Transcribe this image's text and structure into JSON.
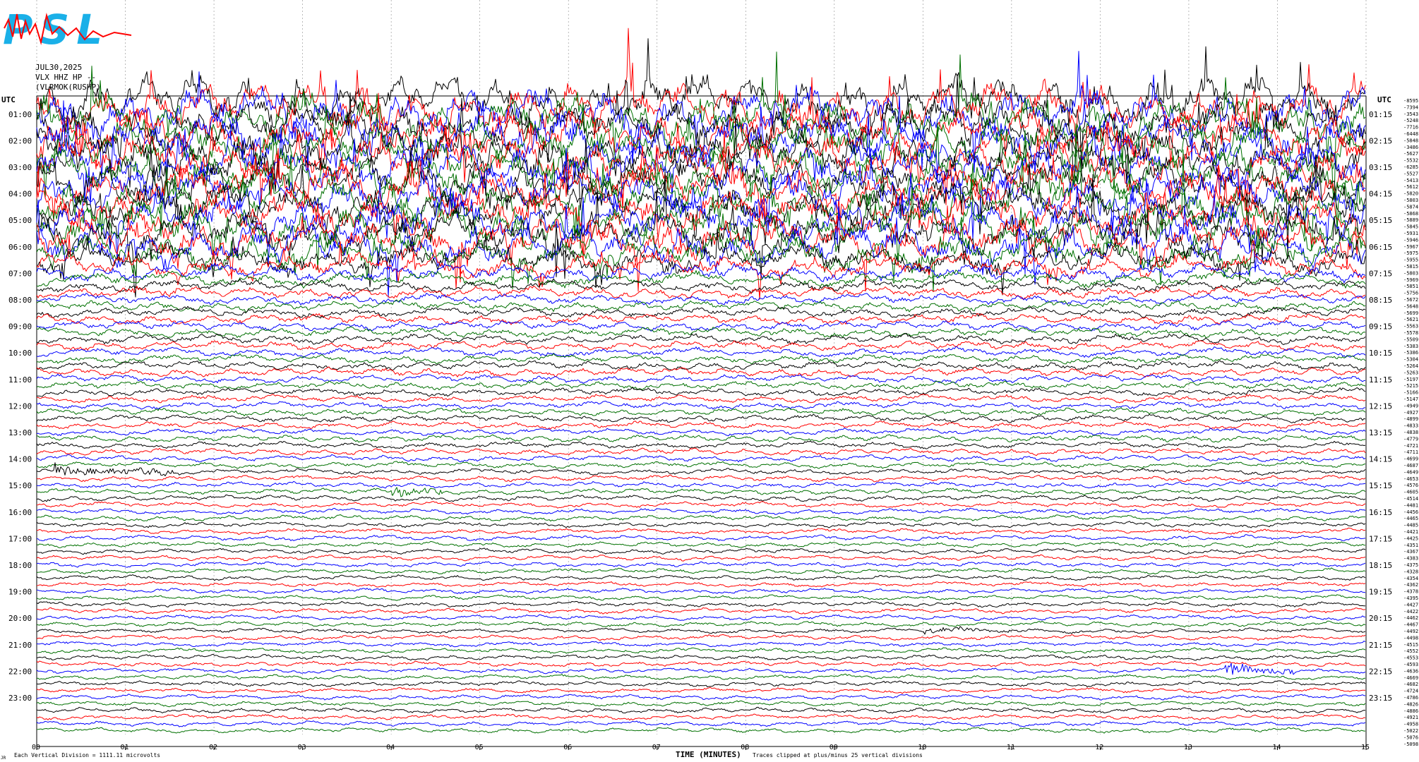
{
  "header": {
    "logo_text": "PSL",
    "date": "JUL30,2025",
    "channel": "VLX HHZ HP --",
    "network": "(VLRMOK(RUSHP)"
  },
  "left_axis": {
    "title": "UTC",
    "labels": [
      "01:00",
      "02:00",
      "03:00",
      "04:00",
      "05:00",
      "06:00",
      "07:00",
      "08:00",
      "09:00",
      "10:00",
      "11:00",
      "12:00",
      "13:00",
      "14:00",
      "15:00",
      "16:00",
      "17:00",
      "18:00",
      "19:00",
      "20:00",
      "21:00",
      "22:00",
      "23:00"
    ]
  },
  "right_axis": {
    "title": "UTC",
    "labels": [
      "01:15",
      "02:15",
      "03:15",
      "04:15",
      "05:15",
      "06:15",
      "07:15",
      "08:15",
      "09:15",
      "10:15",
      "11:15",
      "12:15",
      "13:15",
      "14:15",
      "15:15",
      "16:15",
      "17:15",
      "18:15",
      "19:15",
      "20:15",
      "21:15",
      "22:15",
      "23:15"
    ]
  },
  "offsets": [
    "-8595",
    "-7394",
    "-3543",
    "-5248",
    "-7716",
    "-6448",
    "-5848",
    "-3486",
    "-5627",
    "-5532",
    "-6285",
    "-5527",
    "-5413",
    "-5612",
    "-5820",
    "-5803",
    "-5874",
    "-5868",
    "-5889",
    "-5845",
    "-5931",
    "-5946",
    "-5967",
    "-5975",
    "-5955",
    "-5815",
    "-5803",
    "-5969",
    "-5851",
    "-5756",
    "-5672",
    "-5648",
    "-5699",
    "-5621",
    "-5563",
    "-5578",
    "-5509",
    "-5383",
    "-5386",
    "-5304",
    "-5264",
    "-5263",
    "-5197",
    "-5215",
    "-5166",
    "-5147",
    "-4949",
    "-4927",
    "-4899",
    "-4833",
    "-4838",
    "-4779",
    "-4721",
    "-4711",
    "-4699",
    "-4687",
    "-4649",
    "-4653",
    "-4576",
    "-4605",
    "-4514",
    "-4481",
    "-4456",
    "-4465",
    "-4485",
    "-4421",
    "-4425",
    "-4351",
    "-4367",
    "-4383",
    "-4375",
    "-4328",
    "-4354",
    "-4362",
    "-4378",
    "-4395",
    "-4427",
    "-4422",
    "-4462",
    "-4467",
    "-4492",
    "-4498",
    "-4515",
    "-4552",
    "-4553",
    "-4593",
    "-4636",
    "-4669",
    "-4682",
    "-4724",
    "-4786",
    "-4826",
    "-4886",
    "-4921",
    "-4958",
    "-5022",
    "-5076",
    "-5098"
  ],
  "footer": {
    "division_note": "Each Vertical Division = 1111.11 microvolts",
    "xlabel": "TIME (MINUTES)",
    "clip_note": "Traces clipped at plus/minus 25 vertical divisions",
    "corner_mark": "JR"
  },
  "colors": {
    "trace_cycle": [
      "#000000",
      "#ff0000",
      "#0000ff",
      "#007000"
    ],
    "grid": "#000000",
    "logo_blue": "#1ab0e8",
    "logo_red": "#ff0000"
  },
  "chart_data": {
    "type": "line",
    "title": "",
    "xlabel": "TIME (MINUTES)",
    "ylabel": "UTC",
    "x_ticks": [
      "00",
      "01",
      "02",
      "03",
      "04",
      "05",
      "06",
      "07",
      "08",
      "09",
      "10",
      "11",
      "12",
      "13",
      "14",
      "15"
    ],
    "xlim": [
      0,
      15
    ],
    "rows_per_hour": 4,
    "row_minutes": 15,
    "row_count": 96,
    "clip_divisions": 25,
    "microvolts_per_division": 1111.11,
    "amplitude_profile": [
      [
        0,
        28
      ],
      [
        6,
        28
      ],
      [
        16,
        26
      ],
      [
        22,
        24
      ],
      [
        26,
        10
      ],
      [
        28,
        7
      ],
      [
        30,
        6
      ],
      [
        40,
        5
      ],
      [
        44,
        4.5
      ],
      [
        56,
        3.5
      ],
      [
        70,
        3
      ],
      [
        96,
        3
      ]
    ],
    "events": [
      {
        "row": 29,
        "start_minute": 1.0,
        "end_minute": 1.6,
        "amplitude": 4
      },
      {
        "row": 56,
        "start_minute": 0.2,
        "end_minute": 1.6,
        "amplitude": 6
      },
      {
        "row": 59,
        "start_minute": 4.0,
        "end_minute": 4.6,
        "amplitude": 6
      },
      {
        "row": 80,
        "start_minute": 10.0,
        "end_minute": 11.0,
        "amplitude": 3
      },
      {
        "row": 86,
        "start_minute": 13.4,
        "end_minute": 14.2,
        "amplitude": 7
      }
    ],
    "grid": true
  }
}
